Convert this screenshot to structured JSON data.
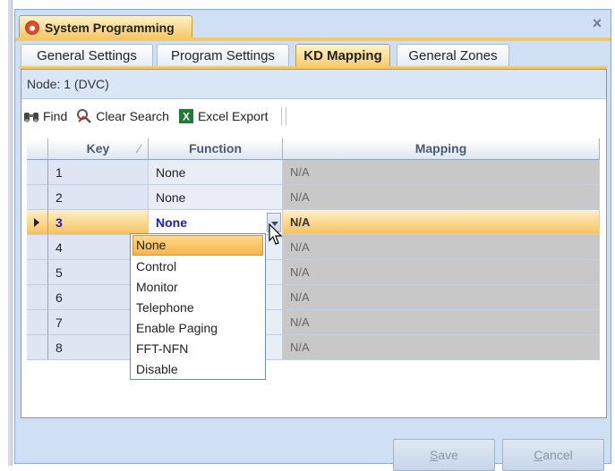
{
  "window": {
    "title": "System Programming",
    "close_glyph": "×"
  },
  "tabs": [
    {
      "label": "General Settings",
      "active": false
    },
    {
      "label": "Program Settings",
      "active": false
    },
    {
      "label": "KD Mapping",
      "active": true
    },
    {
      "label": "General Zones",
      "active": false
    }
  ],
  "node_label": "Node: 1 (DVC)",
  "toolbar": {
    "find": "Find",
    "clear_search": "Clear Search",
    "excel_export": "Excel Export"
  },
  "grid": {
    "columns": {
      "key": "Key",
      "function": "Function",
      "mapping": "Mapping"
    },
    "rows": [
      {
        "key": "1",
        "function": "None",
        "mapping": "N/A"
      },
      {
        "key": "2",
        "function": "None",
        "mapping": "N/A"
      },
      {
        "key": "3",
        "function": "None",
        "mapping": "N/A"
      },
      {
        "key": "4",
        "function": "",
        "mapping": "N/A"
      },
      {
        "key": "5",
        "function": "",
        "mapping": "N/A"
      },
      {
        "key": "6",
        "function": "",
        "mapping": "N/A"
      },
      {
        "key": "7",
        "function": "",
        "mapping": "N/A"
      },
      {
        "key": "8",
        "function": "",
        "mapping": "N/A"
      }
    ]
  },
  "dropdown": {
    "options": [
      "None",
      "Control",
      "Monitor",
      "Telephone",
      "Enable Paging",
      "FFT-NFN",
      "Disable"
    ]
  },
  "buttons": {
    "save_mnemonic": "S",
    "save_rest": "ave",
    "cancel_mnemonic": "C",
    "cancel_rest": "ancel"
  },
  "colors": {
    "accent": "#f7c25e",
    "window_bg": "#cfe0f5",
    "mapping_cell": "#c8c8c8",
    "selected_text": "#1a1ad0"
  }
}
